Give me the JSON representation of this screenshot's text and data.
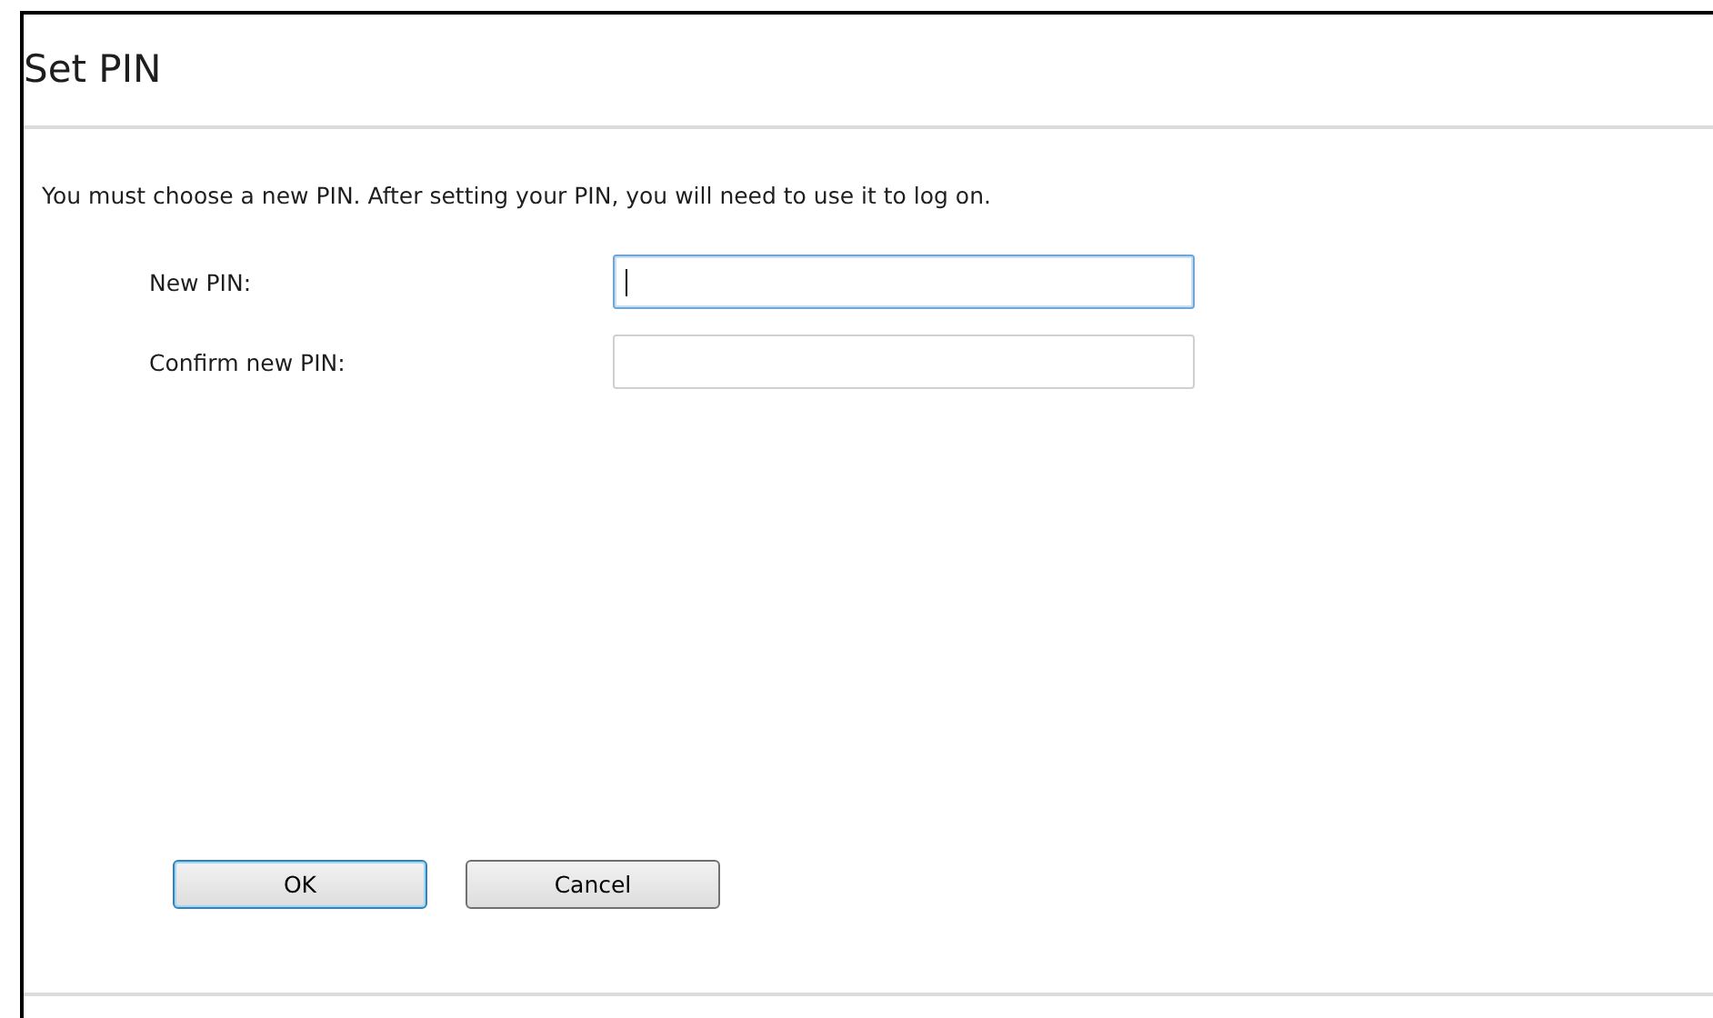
{
  "window": {
    "title": "Set PIN"
  },
  "message": "You must choose a new PIN. After setting your PIN, you will need to use it to log on.",
  "fields": [
    {
      "label": "New PIN:",
      "focused": true
    },
    {
      "label": "Confirm new PIN:",
      "focused": false
    }
  ],
  "buttons": [
    {
      "label": "OK",
      "default": true
    },
    {
      "label": "Cancel",
      "default": false
    }
  ]
}
